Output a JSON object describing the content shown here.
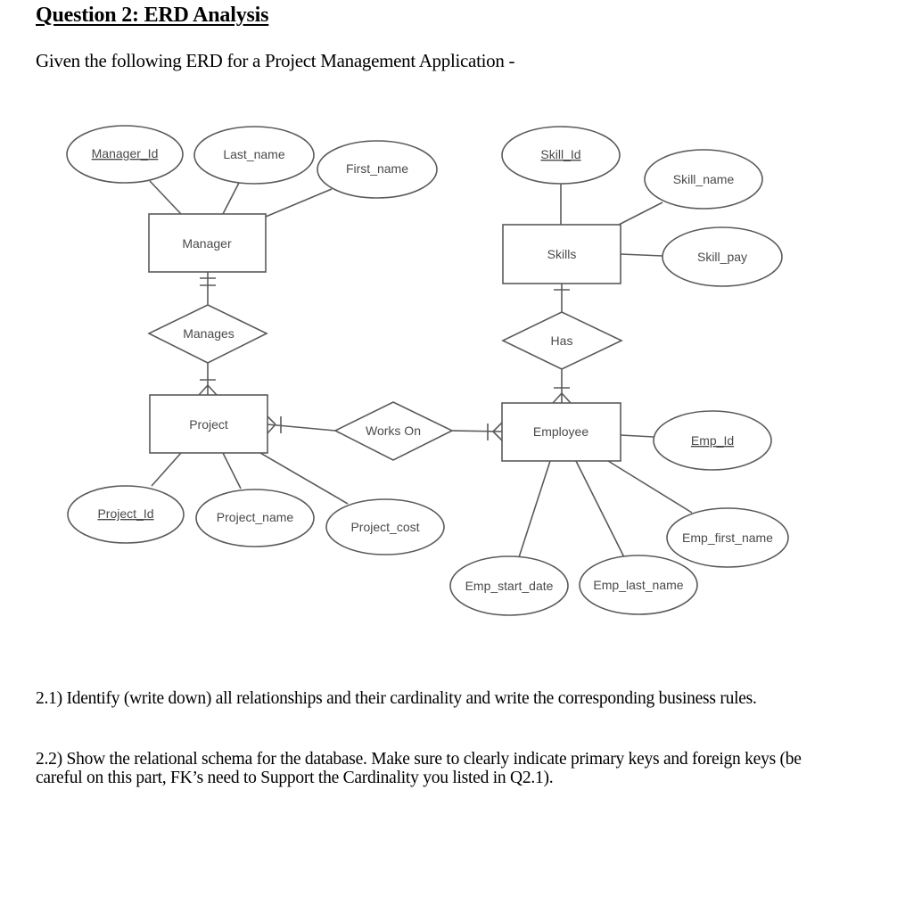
{
  "document": {
    "title": "Question 2: ERD Analysis",
    "intro": "Given the following ERD for a Project Management Application -",
    "questions": [
      {
        "id": "2.1",
        "text": "2.1) Identify (write down) all relationships and their cardinality and write the corresponding business rules."
      },
      {
        "id": "2.2",
        "text": "2.2) Show the relational schema for the database. Make sure to clearly indicate primary keys and foreign keys (be careful on this part, FK’s need to Support the Cardinality you listed in Q2.1)."
      }
    ]
  },
  "erd": {
    "entities": {
      "manager": "Manager",
      "project": "Project",
      "skills": "Skills",
      "employee": "Employee"
    },
    "relationships": {
      "manages": {
        "label": "Manages",
        "between": [
          "Manager",
          "Project"
        ],
        "ends": {
          "Manager": "one-and-only-one",
          "Project": "one-or-many"
        }
      },
      "works_on": {
        "label": "Works On",
        "between": [
          "Project",
          "Employee"
        ],
        "ends": {
          "Project": "one-or-many",
          "Employee": "one-or-many"
        }
      },
      "has": {
        "label": "Has",
        "between": [
          "Skills",
          "Employee"
        ],
        "ends": {
          "Skills": "one",
          "Employee": "one-or-many"
        }
      }
    },
    "attributes": {
      "manager_id": {
        "label": "Manager_Id",
        "entity": "Manager",
        "key": true
      },
      "last_name": {
        "label": "Last_name",
        "entity": "Manager",
        "key": false
      },
      "first_name": {
        "label": "First_name",
        "entity": "Manager",
        "key": false
      },
      "skill_id": {
        "label": "Skill_Id",
        "entity": "Skills",
        "key": true
      },
      "skill_name": {
        "label": "Skill_name",
        "entity": "Skills",
        "key": false
      },
      "skill_pay": {
        "label": "Skill_pay",
        "entity": "Skills",
        "key": false
      },
      "project_id": {
        "label": "Project_Id",
        "entity": "Project",
        "key": true
      },
      "project_name": {
        "label": "Project_name",
        "entity": "Project",
        "key": false
      },
      "project_cost": {
        "label": "Project_cost",
        "entity": "Project",
        "key": false
      },
      "emp_id": {
        "label": "Emp_Id",
        "entity": "Employee",
        "key": true
      },
      "emp_first_name": {
        "label": "Emp_first_name",
        "entity": "Employee",
        "key": false
      },
      "emp_last_name": {
        "label": "Emp_last_name",
        "entity": "Employee",
        "key": false
      },
      "emp_start_date": {
        "label": "Emp_start_date",
        "entity": "Employee",
        "key": false
      }
    }
  }
}
